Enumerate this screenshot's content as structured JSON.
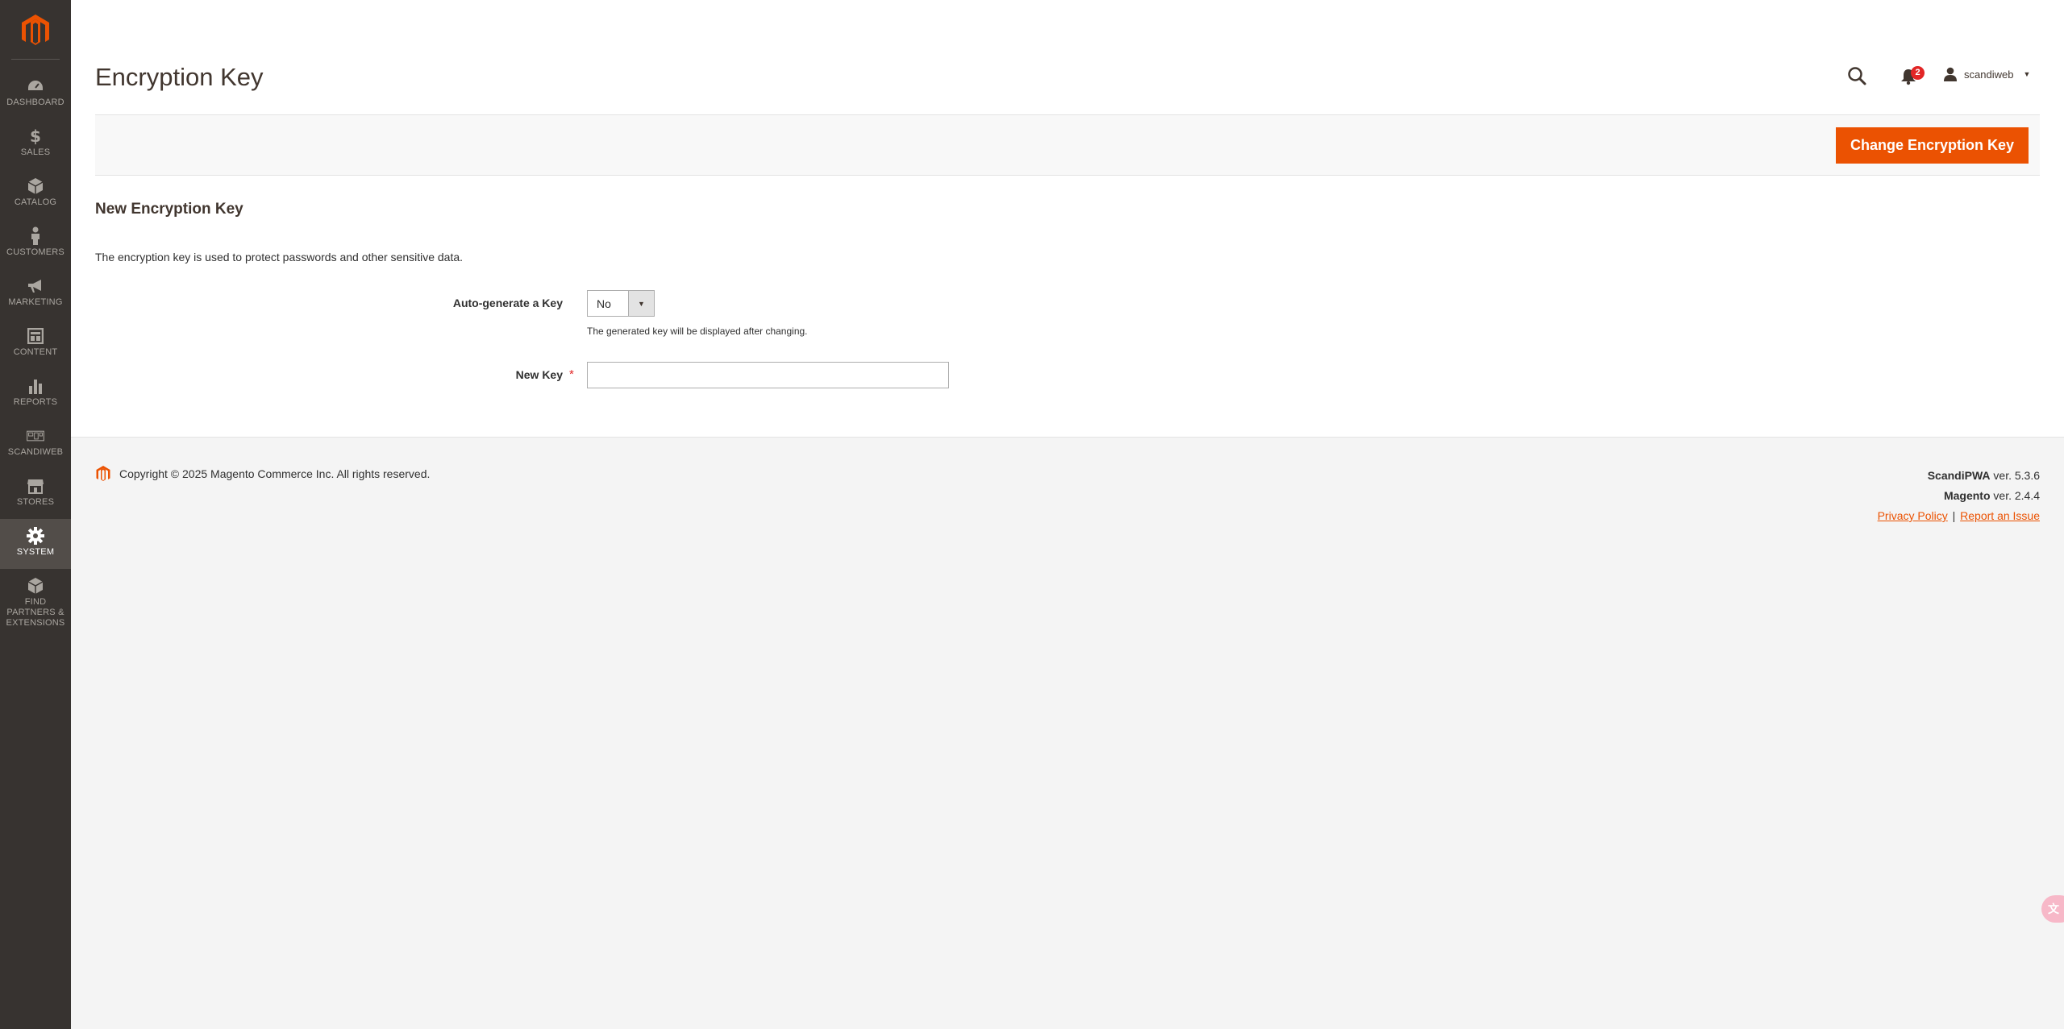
{
  "sidebar": {
    "items": [
      {
        "label": "DASHBOARD",
        "icon": "dashboard-icon"
      },
      {
        "label": "SALES",
        "icon": "dollar-icon"
      },
      {
        "label": "CATALOG",
        "icon": "cube-icon"
      },
      {
        "label": "CUSTOMERS",
        "icon": "person-icon"
      },
      {
        "label": "MARKETING",
        "icon": "megaphone-icon"
      },
      {
        "label": "CONTENT",
        "icon": "layout-icon"
      },
      {
        "label": "REPORTS",
        "icon": "bar-chart-icon"
      },
      {
        "label": "SCANDIWEB",
        "icon": "scandiweb-icon"
      },
      {
        "label": "STORES",
        "icon": "store-icon"
      },
      {
        "label": "SYSTEM",
        "icon": "gear-icon"
      },
      {
        "label": "FIND PARTNERS & EXTENSIONS",
        "icon": "box-icon"
      }
    ],
    "active": "SYSTEM"
  },
  "header": {
    "title": "Encryption Key",
    "notification_count": "2",
    "username": "scandiweb"
  },
  "actions": {
    "primary_label": "Change Encryption Key"
  },
  "form": {
    "section_title": "New Encryption Key",
    "intro": "The encryption key is used to protect passwords and other sensitive data.",
    "auto_generate_label": "Auto-generate a Key",
    "auto_generate_value": "No",
    "auto_generate_note": "The generated key will be displayed after changing.",
    "new_key_label": "New Key",
    "new_key_value": ""
  },
  "footer": {
    "copyright": "Copyright © 2025 Magento Commerce Inc. All rights reserved.",
    "scandipwa_name": "ScandiPWA",
    "scandipwa_version": " ver. 5.3.6",
    "magento_name": "Magento",
    "magento_version": " ver. 2.4.4",
    "privacy_link": "Privacy Policy",
    "separator": "|",
    "report_link": "Report an Issue"
  },
  "colors": {
    "sidebar_bg": "#373330",
    "accent": "#eb5202",
    "badge": "#e22626"
  }
}
